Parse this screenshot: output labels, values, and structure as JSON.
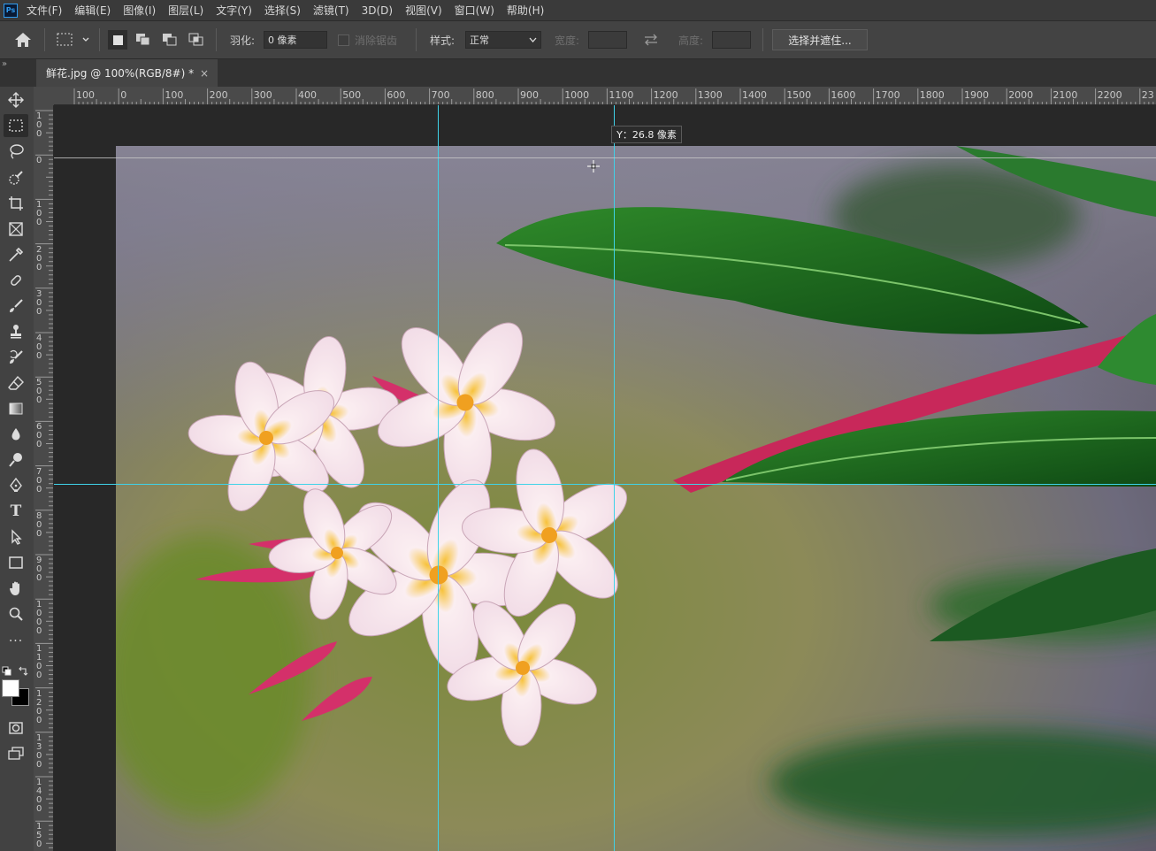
{
  "app": {
    "logo": "Ps"
  },
  "menu": [
    "文件(F)",
    "编辑(E)",
    "图像(I)",
    "图层(L)",
    "文字(Y)",
    "选择(S)",
    "滤镜(T)",
    "3D(D)",
    "视图(V)",
    "窗口(W)",
    "帮助(H)"
  ],
  "options": {
    "feather_label": "羽化:",
    "feather_value": "0 像素",
    "antialias_label": "消除锯齿",
    "style_label": "样式:",
    "style_value": "正常",
    "width_label": "宽度:",
    "height_label": "高度:",
    "select_mask_button": "选择并遮住..."
  },
  "document": {
    "tab_title": "鲜花.jpg @ 100%(RGB/8#) *",
    "close": "×"
  },
  "ruler": {
    "h_labels": [
      "100",
      "0",
      "100",
      "200",
      "300",
      "400",
      "500",
      "600",
      "700",
      "800",
      "900",
      "1000",
      "1100",
      "1200",
      "1300",
      "1400",
      "1500",
      "1600",
      "1700",
      "1800",
      "1900",
      "2000",
      "2100",
      "2200",
      "23"
    ],
    "v_labels": [
      "100",
      "0",
      "100",
      "200",
      "300",
      "400",
      "500",
      "600",
      "700",
      "800",
      "900",
      "1000",
      "1100",
      "1200",
      "1300",
      "1400",
      "150"
    ]
  },
  "tooltip": "Y：26.8 像素",
  "icons": {
    "home": "home-icon",
    "marquee": "rect-marquee-icon",
    "move": "move-icon",
    "lasso": "lasso-icon",
    "quick_select": "quick-select-icon",
    "crop": "crop-icon",
    "frame": "frame-icon",
    "eyedropper": "eyedropper-icon",
    "healing": "healing-brush-icon",
    "brush": "brush-icon",
    "stamp": "clone-stamp-icon",
    "history_brush": "history-brush-icon",
    "eraser": "eraser-icon",
    "gradient": "gradient-icon",
    "blur": "blur-icon",
    "dodge": "dodge-icon",
    "pen": "pen-icon",
    "type": "type-icon",
    "path_select": "path-selection-icon",
    "shape": "rectangle-shape-icon",
    "hand": "hand-icon",
    "zoom": "zoom-icon",
    "more": "more-tools-icon"
  },
  "colors": {
    "guide": "#3fd2e8",
    "foreground": "#ffffff",
    "background": "#000000"
  }
}
